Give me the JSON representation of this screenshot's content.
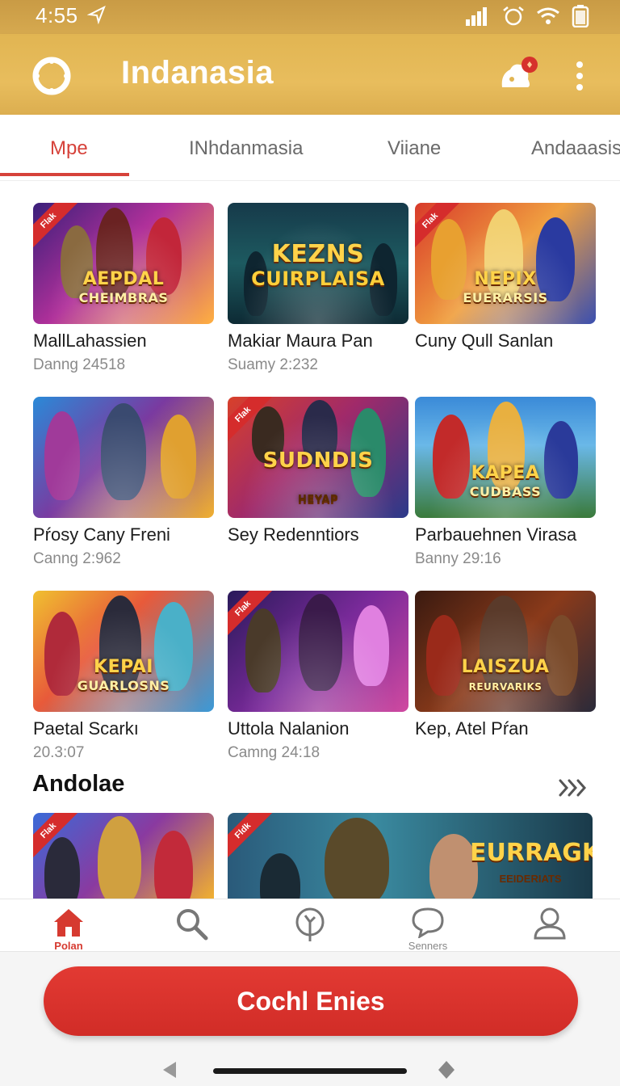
{
  "status_bar": {
    "time": "4:55"
  },
  "app_bar": {
    "title": "Indanasia"
  },
  "tabs": [
    {
      "label": "Mpe",
      "active": true
    },
    {
      "label": "INhdanmasia",
      "active": false
    },
    {
      "label": "Viiane",
      "active": false
    },
    {
      "label": "Andaaasis",
      "active": false
    }
  ],
  "games": [
    {
      "title": "MallLahassien",
      "subtitle": "Danng 24518",
      "ribbon": "Flak",
      "art_title": "AEPDAL",
      "art_sub": "CHEIMBRAS"
    },
    {
      "title": "Makiar Maura Pan",
      "subtitle": "Suamy 2:232",
      "ribbon": "",
      "art_title": "KEZNS",
      "art_sub": "CUIRPLAISA"
    },
    {
      "title": "Cuny Qull Sanlan",
      "subtitle": "",
      "ribbon": "Flak",
      "art_title": "NEPIX",
      "art_sub": "EUERARSIS"
    },
    {
      "title": "Pŕosy Cany Freni",
      "subtitle": "Canng 2:962",
      "ribbon": "",
      "art_title": "",
      "art_sub": ""
    },
    {
      "title": "Sey Redenntiors",
      "subtitle": "",
      "ribbon": "Flak",
      "art_title": "SUDNDIS",
      "art_sub": "HEYAP"
    },
    {
      "title": "Parbauehnen Virasa",
      "subtitle": "Banny 29:16",
      "ribbon": "",
      "art_title": "KAPEA",
      "art_sub": "CUDBASS"
    },
    {
      "title": "Paetal Scarkı",
      "subtitle": "20.3:07",
      "ribbon": "",
      "art_title": "KEPAI",
      "art_sub": "GUARLOSNS"
    },
    {
      "title": "Uttola Nalanion",
      "subtitle": "Camng 24:18",
      "ribbon": "Flak",
      "art_title": "",
      "art_sub": ""
    },
    {
      "title": "Kep, Atel  Pŕan",
      "subtitle": "",
      "ribbon": "",
      "art_title": "LAISZUA",
      "art_sub": "REURVARIKS"
    }
  ],
  "section": {
    "title": "Andolae"
  },
  "featured": [
    {
      "ribbon": "Flak",
      "art_title": ""
    },
    {
      "ribbon": "Fldk",
      "art_title": "EURRAGK",
      "art_sub": "EEIDERIATS"
    }
  ],
  "bottom_nav": [
    {
      "label": "Polan",
      "icon": "home-icon",
      "active": true
    },
    {
      "label": "",
      "icon": "search-icon",
      "active": false
    },
    {
      "label": "",
      "icon": "pin-icon",
      "active": false
    },
    {
      "label": "Senners",
      "icon": "chat-icon",
      "active": false
    },
    {
      "label": "",
      "icon": "profile-icon",
      "active": false
    }
  ],
  "cta": {
    "label": "Cochl Enies"
  },
  "colors": {
    "accent": "#d6423a",
    "appbar": "#e1b552"
  }
}
